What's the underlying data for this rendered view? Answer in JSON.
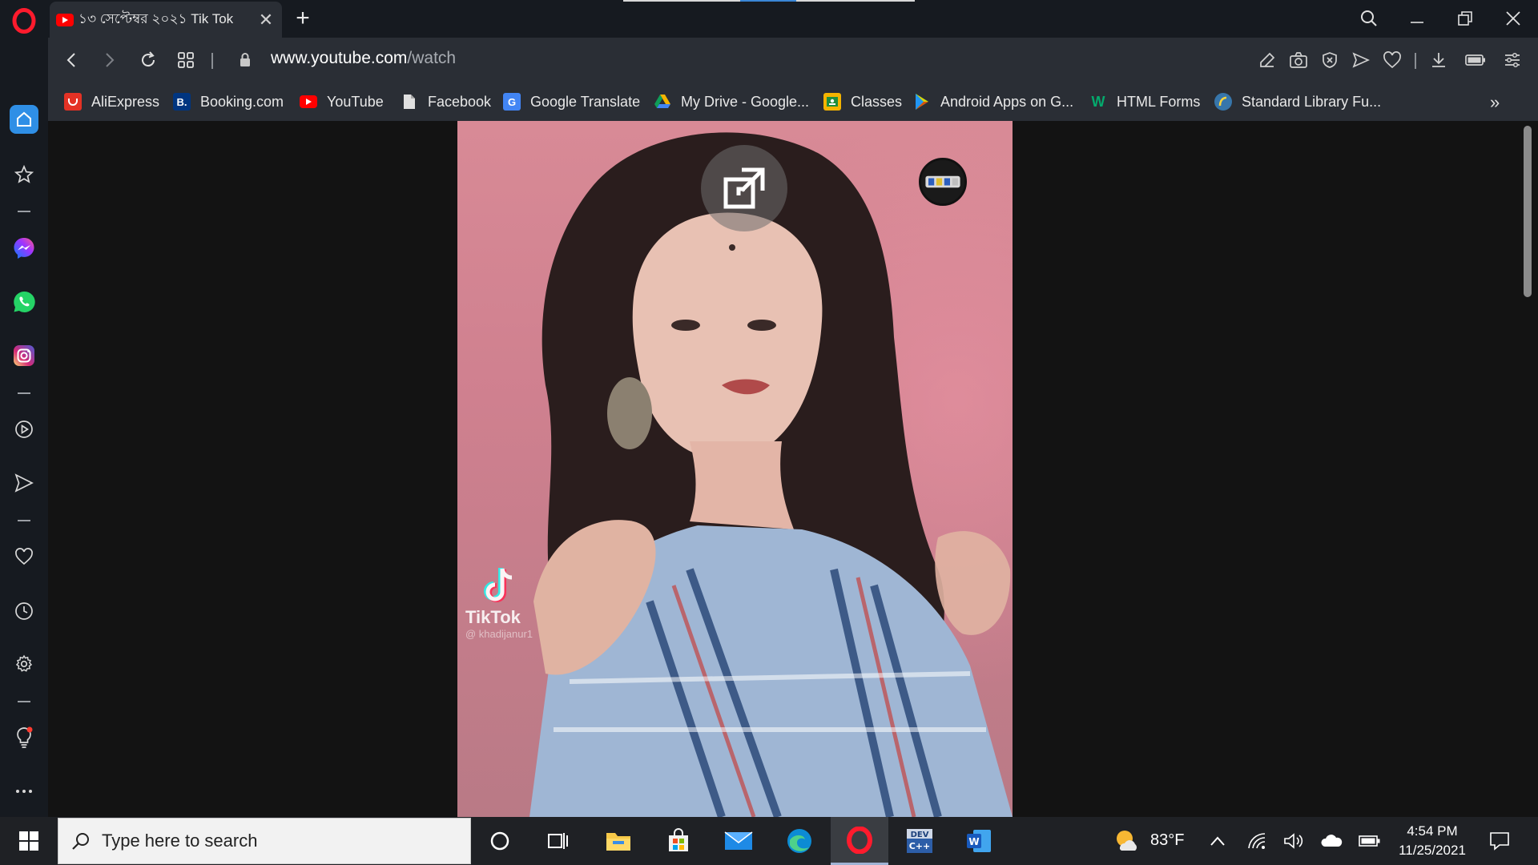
{
  "browser": {
    "tab": {
      "title": "১৩ সেপ্টেম্বর ২০২১ Tik Tok",
      "close_label": "✕"
    },
    "new_tab_label": "+",
    "address": {
      "url_host": "www.youtube.com",
      "url_path": "/watch"
    },
    "window_controls": {
      "minimize": "—",
      "restore": "❐",
      "close": "✕"
    }
  },
  "bookmarks": [
    {
      "label": "AliExpress",
      "icon": "aliexpress-icon",
      "color": "#e43225"
    },
    {
      "label": "Booking.com",
      "icon": "booking-icon",
      "color": "#003580"
    },
    {
      "label": "YouTube",
      "icon": "youtube-icon",
      "color": "#ff0000"
    },
    {
      "label": "Facebook",
      "icon": "document-icon",
      "color": "#e8e8e8"
    },
    {
      "label": "Google Translate",
      "icon": "google-translate-icon",
      "color": "#4285f4"
    },
    {
      "label": "My Drive - Google...",
      "icon": "google-drive-icon",
      "color": "#0f9d58"
    },
    {
      "label": "Classes",
      "icon": "google-classroom-icon",
      "color": "#f4b400"
    },
    {
      "label": "Android Apps on G...",
      "icon": "google-play-icon",
      "color": "#00c853"
    },
    {
      "label": "HTML Forms",
      "icon": "w3schools-icon",
      "color": "#04aa6d"
    },
    {
      "label": "Standard Library Fu...",
      "icon": "python-docs-icon",
      "color": "#3776ab"
    }
  ],
  "bookmarks_more": "»",
  "video": {
    "watermark": "TikTok",
    "handle": "@ khadijanur1"
  },
  "taskbar": {
    "search_placeholder": "Type here to search",
    "weather_temp": "83°F",
    "time": "4:54 PM",
    "date": "11/25/2021"
  },
  "colors": {
    "accent": "#3a86d6",
    "opera_red": "#ff1b2d",
    "sidebar_bg": "#161a20",
    "toolbar_bg": "#2a2e35"
  }
}
